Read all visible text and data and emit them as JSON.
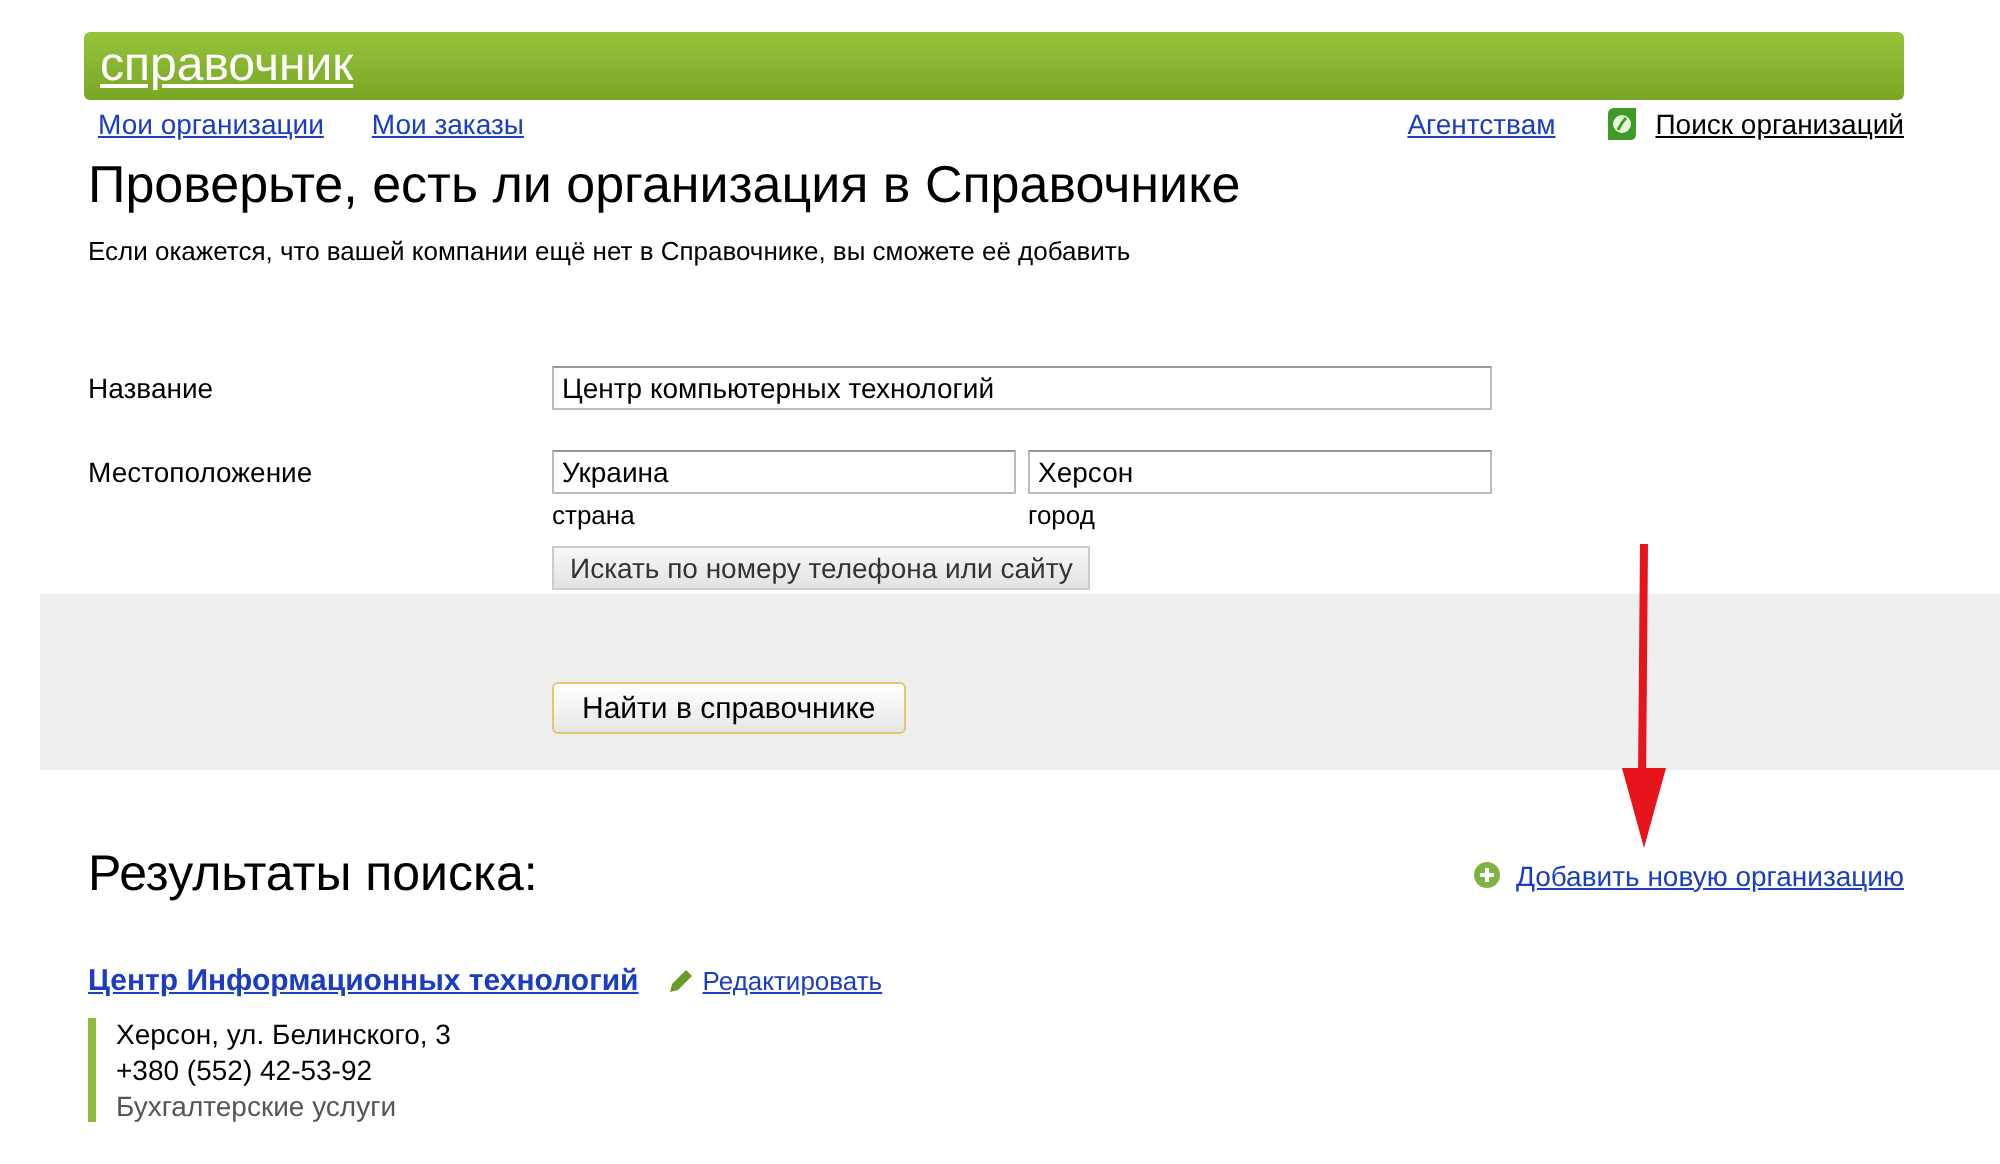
{
  "header": {
    "logo": "справочник"
  },
  "nav": {
    "left": [
      "Мои организации",
      "Мои заказы"
    ],
    "agencies": "Агентствам",
    "search_link": "Поиск организаций"
  },
  "title": "Проверьте, есть ли организация в Справочнике",
  "subtitle": "Если окажется, что вашей компании ещё нет в Справочнике, вы сможете её добавить",
  "form": {
    "name_label": "Название",
    "name_value": "Центр компьютерных технологий",
    "location_label": "Местоположение",
    "country_value": "Украина",
    "country_hint": "страна",
    "city_value": "Херсон",
    "city_hint": "город",
    "phone_button": "Искать по номеру телефона или сайту",
    "find_button": "Найти в справочнике"
  },
  "results": {
    "title": "Результаты поиска:",
    "add_link": "Добавить новую организацию",
    "items": [
      {
        "name": "Центр Информационных технологий",
        "edit": "Редактировать",
        "address": "Херсон, ул. Белинского, 3",
        "phone": "+380 (552) 42-53-92",
        "category": "Бухгалтерские услуги"
      }
    ]
  }
}
